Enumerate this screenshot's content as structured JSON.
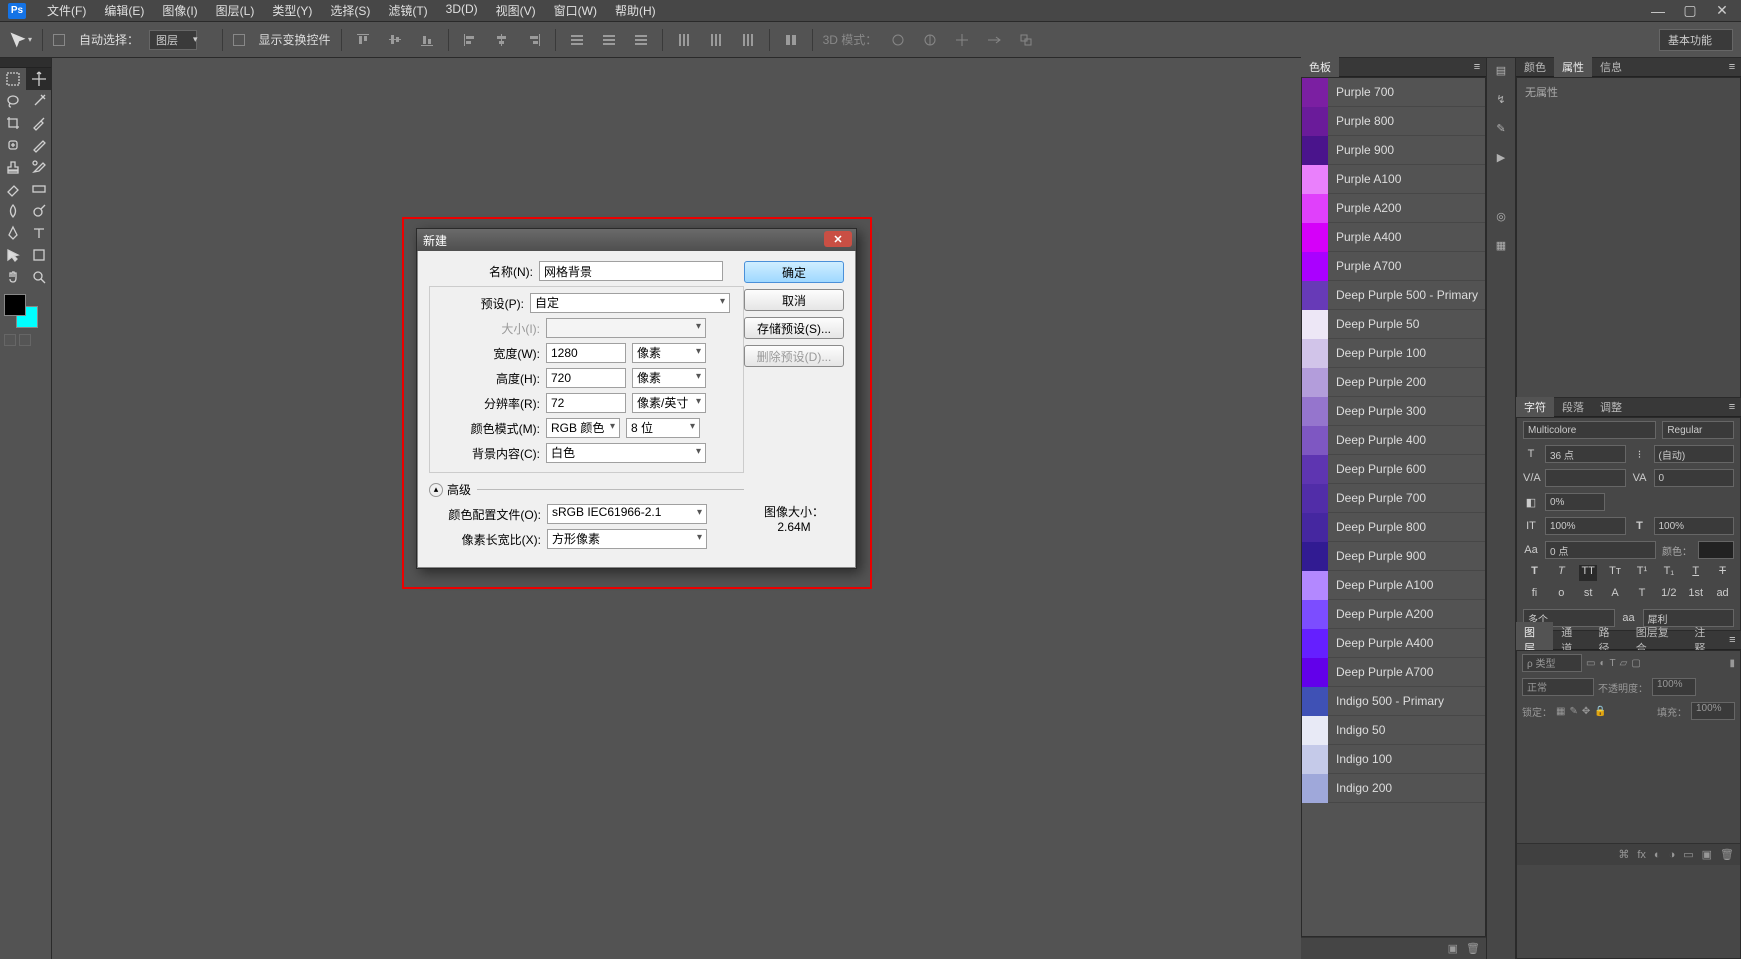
{
  "app": {
    "logo": "Ps"
  },
  "menu": [
    "文件(F)",
    "编辑(E)",
    "图像(I)",
    "图层(L)",
    "类型(Y)",
    "选择(S)",
    "滤镜(T)",
    "3D(D)",
    "视图(V)",
    "窗口(W)",
    "帮助(H)"
  ],
  "options": {
    "auto_select": "自动选择：",
    "layer_dd": "图层",
    "show_transform": "显示变换控件",
    "mode3d": "3D 模式：",
    "basic_btn": "基本功能"
  },
  "dialog": {
    "title": "新建",
    "name_label": "名称(N):",
    "name_value": "网格背景",
    "preset_label": "预设(P):",
    "preset_value": "自定",
    "size_label": "大小(I):",
    "width_label": "宽度(W):",
    "width_value": "1280",
    "width_unit": "像素",
    "height_label": "高度(H):",
    "height_value": "720",
    "height_unit": "像素",
    "res_label": "分辨率(R):",
    "res_value": "72",
    "res_unit": "像素/英寸",
    "mode_label": "颜色模式(M):",
    "mode_value": "RGB 颜色",
    "depth_value": "8 位",
    "bg_label": "背景内容(C):",
    "bg_value": "白色",
    "advanced": "高级",
    "profile_label": "颜色配置文件(O):",
    "profile_value": "sRGB IEC61966-2.1",
    "aspect_label": "像素长宽比(X):",
    "aspect_value": "方形像素",
    "ok": "确定",
    "cancel": "取消",
    "save_preset": "存储预设(S)...",
    "delete_preset": "删除预设(D)...",
    "image_size_label": "图像大小：",
    "image_size_value": "2.64M"
  },
  "swatch_panel_tab": "色板",
  "swatches": [
    {
      "name": "Purple 700",
      "hex": "#7b1fa2"
    },
    {
      "name": "Purple 800",
      "hex": "#6a1b9a"
    },
    {
      "name": "Purple 900",
      "hex": "#4a148c"
    },
    {
      "name": "Purple A100",
      "hex": "#ea80fc"
    },
    {
      "name": "Purple A200",
      "hex": "#e040fb"
    },
    {
      "name": "Purple A400",
      "hex": "#d500f9"
    },
    {
      "name": "Purple A700",
      "hex": "#aa00ff"
    },
    {
      "name": "Deep Purple 500 - Primary",
      "hex": "#673ab7"
    },
    {
      "name": "Deep Purple 50",
      "hex": "#ede7f6"
    },
    {
      "name": "Deep Purple 100",
      "hex": "#d1c4e9"
    },
    {
      "name": "Deep Purple 200",
      "hex": "#b39ddb"
    },
    {
      "name": "Deep Purple 300",
      "hex": "#9575cd"
    },
    {
      "name": "Deep Purple 400",
      "hex": "#7e57c2"
    },
    {
      "name": "Deep Purple 600",
      "hex": "#5e35b1"
    },
    {
      "name": "Deep Purple 700",
      "hex": "#512da8"
    },
    {
      "name": "Deep Purple 800",
      "hex": "#4527a0"
    },
    {
      "name": "Deep Purple 900",
      "hex": "#311b92"
    },
    {
      "name": "Deep Purple A100",
      "hex": "#b388ff"
    },
    {
      "name": "Deep Purple A200",
      "hex": "#7c4dff"
    },
    {
      "name": "Deep Purple A400",
      "hex": "#651fff"
    },
    {
      "name": "Deep Purple A700",
      "hex": "#6200ea"
    },
    {
      "name": "Indigo 500 - Primary",
      "hex": "#3f51b5"
    },
    {
      "name": "Indigo 50",
      "hex": "#e8eaf6"
    },
    {
      "name": "Indigo 100",
      "hex": "#c5cae9"
    },
    {
      "name": "Indigo 200",
      "hex": "#9fa8da"
    }
  ],
  "right_tabs": {
    "color": "颜色",
    "props": "属性",
    "info": "信息",
    "noprops": "无属性"
  },
  "char_tabs": {
    "char": "字符",
    "para": "段落",
    "adj": "调整"
  },
  "char": {
    "font": "Multicolore",
    "style": "Regular",
    "size": "36 点",
    "leading": "(自动)",
    "va": "",
    "tracking": "0",
    "pct": "0%",
    "h100": "100%",
    "w100": "100%",
    "baseline": "0 点",
    "color_label": "颜色：",
    "lang": "多个",
    "aa": "aa",
    "sharp": "犀利"
  },
  "layers_tabs": {
    "layers": "图层",
    "channels": "通道",
    "paths": "路径",
    "comps": "图层复合",
    "notes": "注释"
  },
  "layers": {
    "type": "ρ 类型",
    "mode": "正常",
    "opacity_label": "不透明度：",
    "opacity": "100%",
    "lock_label": "锁定：",
    "fill_label": "填充：",
    "fill": "100%"
  }
}
